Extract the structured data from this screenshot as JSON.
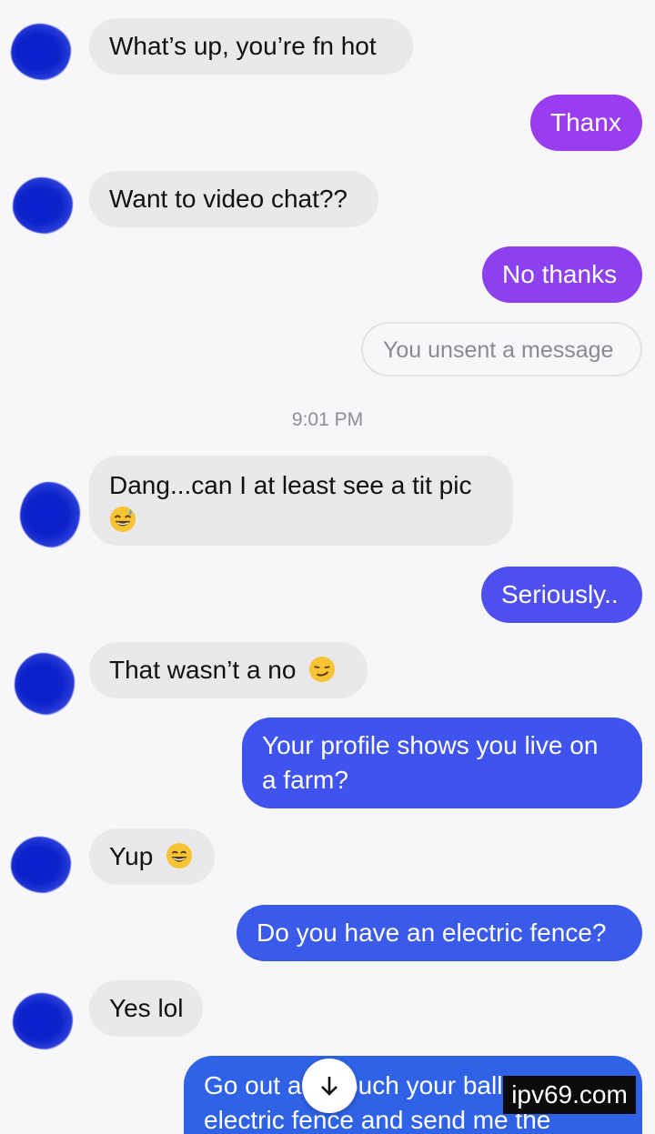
{
  "colors": {
    "incoming_bubble": "#e9e9ec",
    "outgoing_gradient_top": "#9b3cf0",
    "outgoing_gradient_bottom": "#2f5de8",
    "unsent_text": "#8a8a8f",
    "timestamp_text": "#8e8e93"
  },
  "messages": [
    {
      "from": "them",
      "text": "What’s up, you’re fn hot"
    },
    {
      "from": "me",
      "text": "Thanx"
    },
    {
      "from": "them",
      "text": "Want to video chat??"
    },
    {
      "from": "me",
      "text": "No thanks"
    },
    {
      "from": "system",
      "text": "You unsent a message"
    },
    {
      "from": "timestamp",
      "text": "9:01 PM"
    },
    {
      "from": "them",
      "text": "Dang...can I at least see a tit pic",
      "emoji": "grinning-sweat-emoji"
    },
    {
      "from": "me",
      "text": "Seriously.."
    },
    {
      "from": "them",
      "text": "That wasn’t a no",
      "emoji": "smirking-face-emoji"
    },
    {
      "from": "me",
      "text": "Your profile shows you live on",
      "text2": "a farm?"
    },
    {
      "from": "them",
      "text": "Yup",
      "emoji": "grinning-face-emoji"
    },
    {
      "from": "me",
      "text": "Do you have an electric fence?"
    },
    {
      "from": "them",
      "text": "Yes lol"
    },
    {
      "from": "me",
      "text": "Go out and touch your balls on the",
      "text2": "electric fence and send me the"
    }
  ],
  "scroll_down_icon": "arrow-down-icon",
  "watermark": "ipv69.com"
}
